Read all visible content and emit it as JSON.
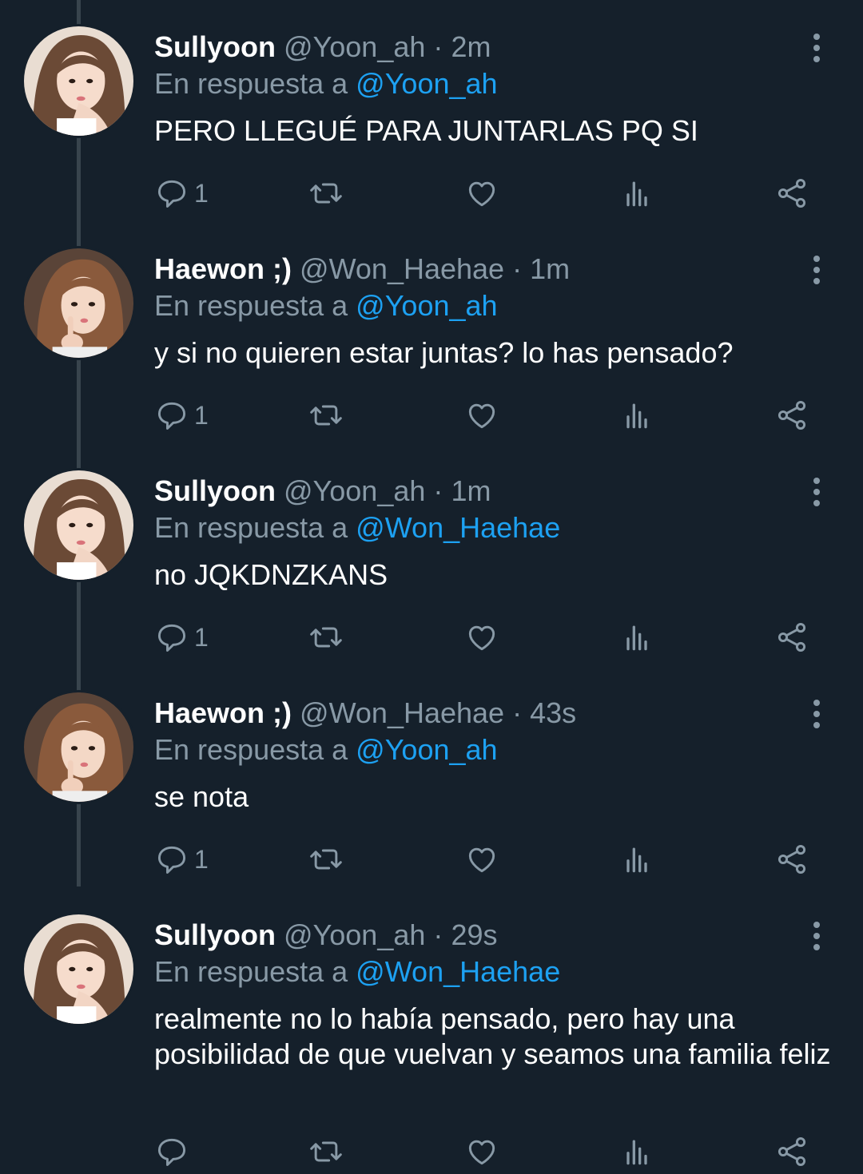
{
  "colors": {
    "background": "#15202b",
    "muted": "#8899a6",
    "link": "#1da1f2",
    "text": "#ffffff"
  },
  "tweets": [
    {
      "name": "Sullyoon",
      "handle": "@Yoon_ah",
      "sep": "·",
      "time": "2m",
      "replying_prefix": "En respuesta a",
      "replying_to": "@Yoon_ah",
      "text": "PERO LLEGUÉ PARA JUNTARLAS PQ SI",
      "replies": "1",
      "avatar": "avatar-sullyoon"
    },
    {
      "name": "Haewon ;)",
      "handle": "@Won_Haehae",
      "sep": "·",
      "time": "1m",
      "replying_prefix": "En respuesta a",
      "replying_to": "@Yoon_ah",
      "text": "y si no quieren estar juntas? lo has pensado?",
      "replies": "1",
      "avatar": "avatar-haewon"
    },
    {
      "name": "Sullyoon",
      "handle": "@Yoon_ah",
      "sep": "·",
      "time": "1m",
      "replying_prefix": "En respuesta a",
      "replying_to": "@Won_Haehae",
      "text": "no JQKDNZKANS",
      "replies": "1",
      "avatar": "avatar-sullyoon"
    },
    {
      "name": "Haewon ;)",
      "handle": "@Won_Haehae",
      "sep": "·",
      "time": "43s",
      "replying_prefix": "En respuesta a",
      "replying_to": "@Yoon_ah",
      "text": "se nota",
      "replies": "1",
      "avatar": "avatar-haewon"
    },
    {
      "name": "Sullyoon",
      "handle": "@Yoon_ah",
      "sep": "·",
      "time": "29s",
      "replying_prefix": "En respuesta a",
      "replying_to": "@Won_Haehae",
      "text": "realmente no lo había pensado, pero hay una posibilidad de que vuelvan y seamos una familia feliz",
      "replies": "",
      "avatar": "avatar-sullyoon"
    }
  ],
  "icons": {
    "reply": "reply-icon",
    "retweet": "retweet-icon",
    "like": "heart-icon",
    "views": "analytics-icon",
    "share": "share-icon",
    "more": "more-vertical-icon"
  }
}
